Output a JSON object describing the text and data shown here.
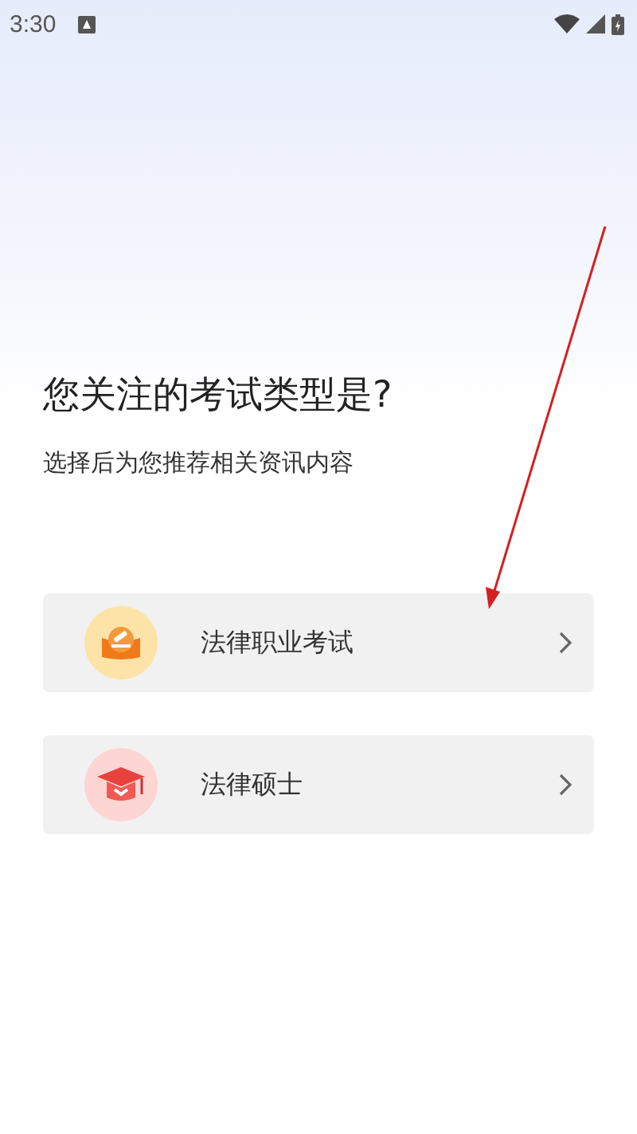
{
  "status_bar": {
    "time": "3:30"
  },
  "title": "您关注的考试类型是?",
  "subtitle": "选择后为您推荐相关资讯内容",
  "options": [
    {
      "kind": "gavel",
      "label": "法律职业考试"
    },
    {
      "kind": "cap",
      "label": "法律硕士"
    }
  ]
}
